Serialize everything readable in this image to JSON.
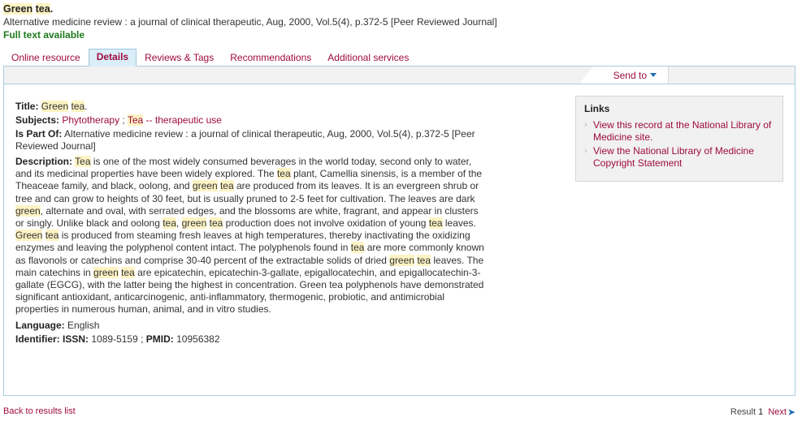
{
  "record": {
    "title_plain": "Green tea.",
    "title_parts": [
      {
        "text": "Green",
        "highlight": true
      },
      {
        "text": " ",
        "highlight": false
      },
      {
        "text": "tea",
        "highlight": true
      },
      {
        "text": ".",
        "highlight": false
      }
    ],
    "source": "Alternative medicine review : a journal of clinical therapeutic, Aug, 2000, Vol.5(4), p.372-5 [Peer Reviewed Journal]",
    "full_text_status": "Full text available"
  },
  "tabs": [
    {
      "label": "Online resource",
      "active": false
    },
    {
      "label": "Details",
      "active": true
    },
    {
      "label": "Reviews & Tags",
      "active": false
    },
    {
      "label": "Recommendations",
      "active": false
    },
    {
      "label": "Additional services",
      "active": false
    }
  ],
  "toolbar": {
    "send_to_label": "Send to",
    "chevron_icon": "chevron-down-icon"
  },
  "details": {
    "title": {
      "label": "Title:",
      "parts": [
        {
          "text": "Green",
          "highlight": true
        },
        {
          "text": " ",
          "highlight": false
        },
        {
          "text": "tea",
          "highlight": true
        },
        {
          "text": ".",
          "highlight": false
        }
      ]
    },
    "subjects": {
      "label": "Subjects:",
      "links": [
        {
          "parts": [
            {
              "text": "Phytotherapy",
              "highlight": false
            }
          ]
        },
        {
          "parts": [
            {
              "text": "Tea",
              "highlight": true
            },
            {
              "text": " -- therapeutic use",
              "highlight": false
            }
          ]
        }
      ],
      "separator": " ; "
    },
    "is_part_of": {
      "label": "Is Part Of:",
      "value": "Alternative medicine review : a journal of clinical therapeutic, Aug, 2000, Vol.5(4), p.372-5 [Peer Reviewed Journal]"
    },
    "description": {
      "label": "Description:",
      "parts": [
        {
          "text": "Tea",
          "highlight": true
        },
        {
          "text": " is one of the most widely consumed beverages in the world today, second only to water, and its medicinal properties have been widely explored. The ",
          "highlight": false
        },
        {
          "text": "tea",
          "highlight": true
        },
        {
          "text": " plant, Camellia sinensis, is a member of the Theaceae family, and black, oolong, and ",
          "highlight": false
        },
        {
          "text": "green",
          "highlight": true
        },
        {
          "text": " ",
          "highlight": false
        },
        {
          "text": "tea",
          "highlight": true
        },
        {
          "text": " are produced from its leaves. It is an evergreen shrub or tree and can grow to heights of 30 feet, but is usually pruned to 2-5 feet for cultivation. The leaves are dark ",
          "highlight": false
        },
        {
          "text": "green",
          "highlight": true
        },
        {
          "text": ", alternate and oval, with serrated edges, and the blossoms are white, fragrant, and appear in clusters or singly. Unlike black and oolong ",
          "highlight": false
        },
        {
          "text": "tea",
          "highlight": true
        },
        {
          "text": ", ",
          "highlight": false
        },
        {
          "text": "green",
          "highlight": true
        },
        {
          "text": " ",
          "highlight": false
        },
        {
          "text": "tea",
          "highlight": true
        },
        {
          "text": " production does not involve oxidation of young ",
          "highlight": false
        },
        {
          "text": "tea",
          "highlight": true
        },
        {
          "text": " leaves. ",
          "highlight": false
        },
        {
          "text": "Green",
          "highlight": true
        },
        {
          "text": " ",
          "highlight": false
        },
        {
          "text": "tea",
          "highlight": true
        },
        {
          "text": " is produced from steaming fresh leaves at high temperatures, thereby inactivating the oxidizing enzymes and leaving the polyphenol content intact. The polyphenols found in ",
          "highlight": false
        },
        {
          "text": "tea",
          "highlight": true
        },
        {
          "text": " are more commonly known as flavonols or catechins and comprise 30-40 percent of the extractable solids of dried ",
          "highlight": false
        },
        {
          "text": "green",
          "highlight": true
        },
        {
          "text": " ",
          "highlight": false
        },
        {
          "text": "tea",
          "highlight": true
        },
        {
          "text": " leaves. The main catechins in ",
          "highlight": false
        },
        {
          "text": "green",
          "highlight": true
        },
        {
          "text": " ",
          "highlight": false
        },
        {
          "text": "tea",
          "highlight": true
        },
        {
          "text": " are epicatechin, epicatechin-3-gallate, epigallocatechin, and epigallocatechin-3-gallate (EGCG), with the latter being the highest in concentration. Green tea polyphenols have demonstrated significant antioxidant, anticarcinogenic, anti-inflammatory, thermogenic, probiotic, and antimicrobial properties in numerous human, animal, and in vitro studies.",
          "highlight": false
        }
      ]
    },
    "language": {
      "label": "Language:",
      "value": "English"
    },
    "identifier": {
      "label": "Identifier:",
      "issn_label": "ISSN:",
      "issn_value": "1089-5159",
      "separator": " ; ",
      "pmid_label": "PMID:",
      "pmid_value": "10956382"
    }
  },
  "links_box": {
    "title": "Links",
    "bullet_icon": "chevron-right-icon",
    "items": [
      {
        "label": "View this record at the National Library of Medicine site."
      },
      {
        "label": "View the National Library of Medicine Copyright Statement"
      }
    ]
  },
  "footer": {
    "back_label": "Back to results list",
    "result_label": "Result",
    "result_number": "1",
    "next_label": "Next",
    "next_icon": "arrow-right-icon"
  },
  "colors": {
    "link_crimson": "#9e0b3d",
    "highlight_yellow": "#fdf3c4",
    "fulltext_green": "#1d7a1d",
    "panel_border_blue": "#a9cde0",
    "active_tab_blue": "#daeef8",
    "arrow_blue": "#1f6fb5"
  }
}
